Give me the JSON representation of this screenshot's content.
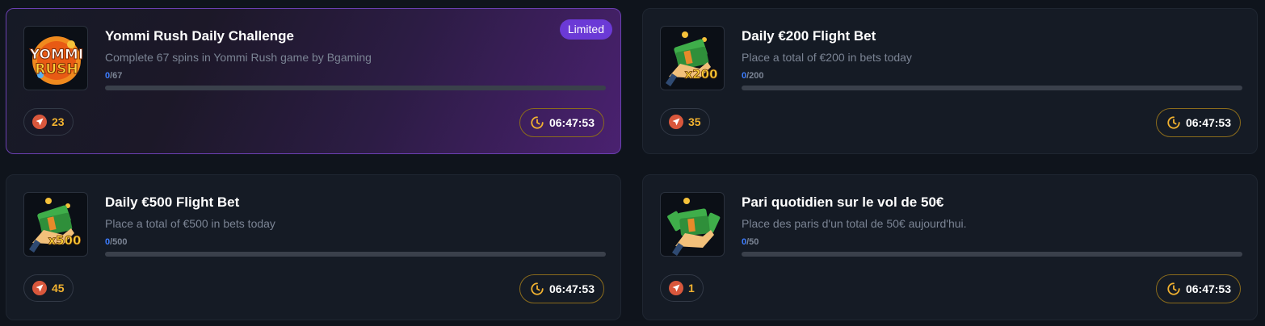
{
  "challenges": [
    {
      "title": "Yommi Rush Daily Challenge",
      "description": "Complete 67 spins in Yommi Rush game by Bgaming",
      "progress_current": "0",
      "progress_total": "/67",
      "progress_fraction": 0,
      "points": "23",
      "timer": "06:47:53",
      "badge": "Limited",
      "thumb_icon": "yommi-rush-logo",
      "thumb_text_top": "YOMMI",
      "thumb_text_bottom": "RUSH"
    },
    {
      "title": "Daily €200 Flight Bet",
      "description": "Place a total of €200 in bets today",
      "progress_current": "0",
      "progress_total": "/200",
      "progress_fraction": 0,
      "points": "35",
      "timer": "06:47:53",
      "thumb_icon": "money-hand-icon",
      "thumb_label": "x200"
    },
    {
      "title": "Daily €500 Flight Bet",
      "description": "Place a total of €500 in bets today",
      "progress_current": "0",
      "progress_total": "/500",
      "progress_fraction": 0,
      "points": "45",
      "timer": "06:47:53",
      "thumb_icon": "money-hand-icon",
      "thumb_label": "x500"
    },
    {
      "title": "Pari quotidien sur le vol de 50€",
      "description": "Place des paris d'un total de 50€ aujourd'hui.",
      "progress_current": "0",
      "progress_total": "/50",
      "progress_fraction": 0,
      "points": "1",
      "timer": "06:47:53",
      "thumb_icon": "money-hand-icon",
      "thumb_label": ""
    }
  ],
  "colors": {
    "accent_blue": "#3d7dff",
    "points_gold": "#f2b230",
    "badge_purple": "#6b3ad6",
    "plane_red": "#d9573c"
  }
}
